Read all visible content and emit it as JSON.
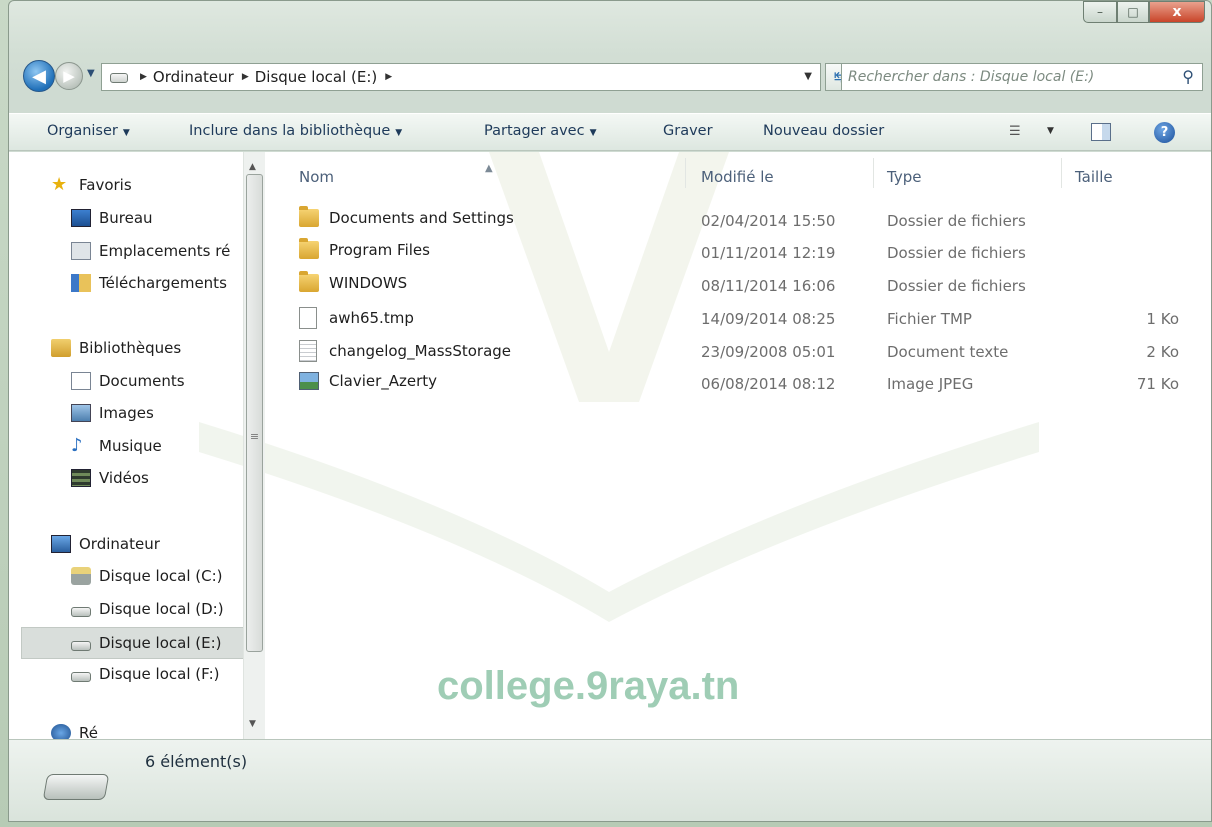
{
  "window": {
    "buttons": {
      "minimize": "–",
      "maximize": "□",
      "close": "x"
    }
  },
  "nav": {
    "back_glyph": "◀",
    "forward_glyph": "▶",
    "breadcrumb": [
      "Ordinateur",
      "Disque local (E:)"
    ],
    "search_placeholder": "Rechercher dans : Disque local (E:)"
  },
  "commands": {
    "organise": "Organiser",
    "include": "Inclure dans la bibliothèque",
    "share": "Partager avec",
    "burn": "Graver",
    "new_folder": "Nouveau dossier"
  },
  "sidebar": {
    "favorites": "Favoris",
    "desktop": "Bureau",
    "recent": "Emplacements ré",
    "downloads": "Téléchargements",
    "libraries": "Bibliothèques",
    "documents": "Documents",
    "images": "Images",
    "music": "Musique",
    "videos": "Vidéos",
    "computer": "Ordinateur",
    "drive_c": "Disque local (C:)",
    "drive_d": "Disque local (D:)",
    "drive_e": "Disque local (E:)",
    "drive_f": "Disque local (F:)",
    "network": "Ré"
  },
  "columns": {
    "name": "Nom",
    "modified": "Modifié le",
    "type": "Type",
    "size": "Taille"
  },
  "files": [
    {
      "name": "Documents and Settings",
      "date": "02/04/2014 15:50",
      "type": "Dossier de fichiers",
      "size": "",
      "kind": "folder"
    },
    {
      "name": "Program Files",
      "date": "01/11/2014 12:19",
      "type": "Dossier de fichiers",
      "size": "",
      "kind": "folder"
    },
    {
      "name": "WINDOWS",
      "date": "08/11/2014 16:06",
      "type": "Dossier de fichiers",
      "size": "",
      "kind": "folder"
    },
    {
      "name": "awh65.tmp",
      "date": "14/09/2014 08:25",
      "type": "Fichier TMP",
      "size": "1 Ko",
      "kind": "file"
    },
    {
      "name": "changelog_MassStorage",
      "date": "23/09/2008 05:01",
      "type": "Document texte",
      "size": "2 Ko",
      "kind": "text"
    },
    {
      "name": "Clavier_Azerty",
      "date": "06/08/2014 08:12",
      "type": "Image JPEG",
      "size": "71 Ko",
      "kind": "image"
    }
  ],
  "status": {
    "count": "6 élément(s)"
  },
  "watermark": "college.9raya.tn",
  "colors": {
    "accent": "#1e3a5a",
    "watermark": "#9fcdb5",
    "selection": "#d9dedb"
  }
}
